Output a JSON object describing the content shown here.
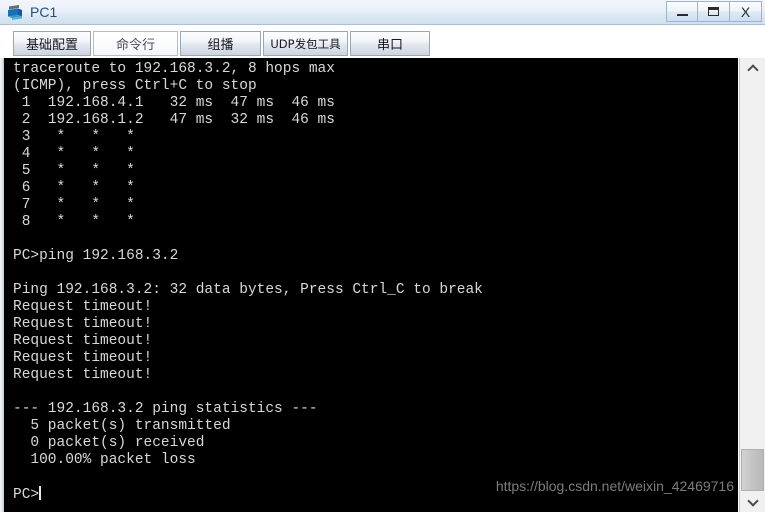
{
  "window": {
    "title": "PC1",
    "icon": "pc-device-icon",
    "controls": {
      "minimize_label": "–",
      "maximize_label": "❐",
      "close_label": "X"
    }
  },
  "tabs": [
    {
      "label": "基础配置",
      "active": false,
      "name": "tab-basic-config"
    },
    {
      "label": "命令行",
      "active": true,
      "name": "tab-command-line"
    },
    {
      "label": "组播",
      "active": false,
      "name": "tab-multicast"
    },
    {
      "label": "UDP发包工具",
      "active": false,
      "name": "tab-udp-tool"
    },
    {
      "label": "串口",
      "active": false,
      "name": "tab-serial-port"
    }
  ],
  "terminal": {
    "background_color": "#000000",
    "text_color": "#d8d8d8",
    "content": "traceroute to 192.168.3.2, 8 hops max\n(ICMP), press Ctrl+C to stop\n 1  192.168.4.1   32 ms  47 ms  46 ms\n 2  192.168.1.2   47 ms  32 ms  46 ms\n 3   *   *   *\n 4   *   *   *\n 5   *   *   *\n 6   *   *   *\n 7   *   *   *\n 8   *   *   *\n\nPC>ping 192.168.3.2\n\nPing 192.168.3.2: 32 data bytes, Press Ctrl_C to break\nRequest timeout!\nRequest timeout!\nRequest timeout!\nRequest timeout!\nRequest timeout!\n\n--- 192.168.3.2 ping statistics ---\n  5 packet(s) transmitted\n  0 packet(s) received\n  100.00% packet loss\n\n",
    "prompt": "PC>",
    "traceroute": {
      "header": "traceroute to 192.168.3.2, 8 hops max",
      "subheader": "(ICMP), press Ctrl+C to stop",
      "target": "192.168.3.2",
      "max_hops": 8,
      "hops": [
        {
          "num": "1",
          "address": "192.168.4.1",
          "rtts": [
            "32 ms",
            "47 ms",
            "46 ms"
          ]
        },
        {
          "num": "2",
          "address": "192.168.1.2",
          "rtts": [
            "47 ms",
            "32 ms",
            "46 ms"
          ]
        },
        {
          "num": "3",
          "address": "*",
          "rtts": [
            "*",
            "*",
            "*"
          ]
        },
        {
          "num": "4",
          "address": "*",
          "rtts": [
            "*",
            "*",
            "*"
          ]
        },
        {
          "num": "5",
          "address": "*",
          "rtts": [
            "*",
            "*",
            "*"
          ]
        },
        {
          "num": "6",
          "address": "*",
          "rtts": [
            "*",
            "*",
            "*"
          ]
        },
        {
          "num": "7",
          "address": "*",
          "rtts": [
            "*",
            "*",
            "*"
          ]
        },
        {
          "num": "8",
          "address": "*",
          "rtts": [
            "*",
            "*",
            "*"
          ]
        }
      ]
    },
    "ping": {
      "command": "PC>ping 192.168.3.2",
      "header": "Ping 192.168.3.2: 32 data bytes, Press Ctrl_C to break",
      "replies": [
        "Request timeout!",
        "Request timeout!",
        "Request timeout!",
        "Request timeout!",
        "Request timeout!"
      ],
      "statistics_title": "--- 192.168.3.2 ping statistics ---",
      "transmitted": "  5 packet(s) transmitted",
      "received": "  0 packet(s) received",
      "loss": "  100.00% packet loss"
    }
  },
  "watermark": {
    "text": "https://blog.csdn.net/weixin_42469716"
  },
  "scrollbar": {
    "up_arrow": "▲",
    "down_arrow": "▼"
  }
}
